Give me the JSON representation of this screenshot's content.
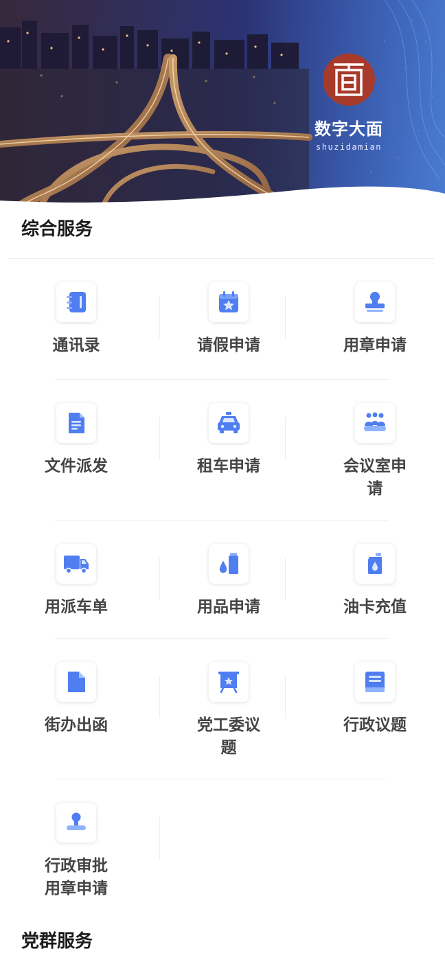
{
  "hero": {
    "brand_name": "数字大面",
    "brand_sub": "shuzidamian",
    "logo_icon": "mian-character-seal-icon"
  },
  "sections": [
    {
      "title": "综合服务",
      "items": [
        {
          "label": "通讯录",
          "icon": "contacts-book-icon"
        },
        {
          "label": "请假申请",
          "icon": "calendar-star-icon"
        },
        {
          "label": "用章申请",
          "icon": "seal-stamp-icon"
        },
        {
          "label": "文件派发",
          "icon": "document-icon"
        },
        {
          "label": "租车申请",
          "icon": "taxi-icon"
        },
        {
          "label": "会议室申请",
          "icon": "meeting-people-icon"
        },
        {
          "label": "用派车单",
          "icon": "truck-icon"
        },
        {
          "label": "用品申请",
          "icon": "supplies-bottle-icon"
        },
        {
          "label": "油卡充值",
          "icon": "oil-can-icon"
        },
        {
          "label": "街办出函",
          "icon": "file-icon"
        },
        {
          "label": "党工委议题",
          "icon": "presentation-board-icon"
        },
        {
          "label": "行政议题",
          "icon": "book-icon"
        },
        {
          "label": "行政审批用章申请",
          "icon": "approval-stamp-icon"
        }
      ]
    },
    {
      "title": "党群服务",
      "items": []
    }
  ],
  "colors": {
    "accent_blue": "#4f7ef0",
    "seal_red": "#a83a2c"
  }
}
